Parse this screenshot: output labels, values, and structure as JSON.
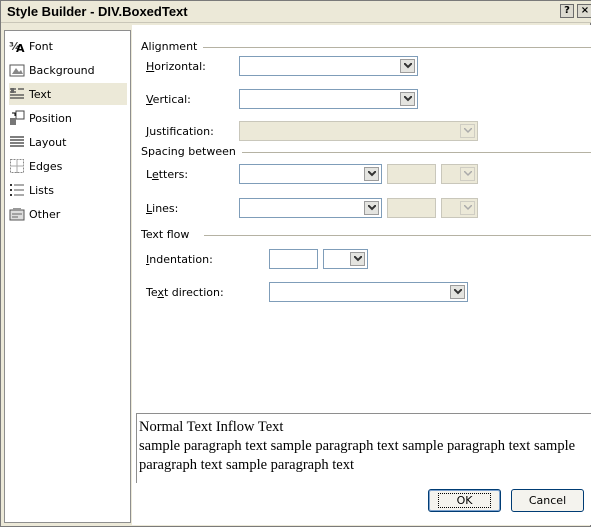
{
  "window": {
    "title": "Style Builder - DIV.BoxedText",
    "help_btn": "?",
    "close_btn": "×"
  },
  "sidebar": {
    "items": [
      {
        "label": "Font",
        "icon": "font-icon"
      },
      {
        "label": "Background",
        "icon": "background-icon"
      },
      {
        "label": "Text",
        "icon": "text-icon",
        "selected": true
      },
      {
        "label": "Position",
        "icon": "position-icon"
      },
      {
        "label": "Layout",
        "icon": "layout-icon"
      },
      {
        "label": "Edges",
        "icon": "edges-icon"
      },
      {
        "label": "Lists",
        "icon": "lists-icon"
      },
      {
        "label": "Other",
        "icon": "other-icon"
      }
    ]
  },
  "alignment": {
    "section": "Alignment",
    "horizontal_key": "H",
    "horizontal_rest": "orizontal:",
    "horizontal_value": "",
    "vertical_key": "V",
    "vertical_rest": "ertical:",
    "vertical_value": "",
    "justification_key": "J",
    "justification_rest": "ustification:",
    "justification_value": ""
  },
  "spacing": {
    "section": "Spacing between",
    "letters_pre": "L",
    "letters_key": "e",
    "letters_rest": "tters:",
    "letters_value": "",
    "letters_amount": "",
    "lines_key": "L",
    "lines_rest": "ines:",
    "lines_value": "",
    "lines_amount": ""
  },
  "textflow": {
    "section": "Text flow",
    "indentation_key": "I",
    "indentation_rest": "ndentation:",
    "indentation_value": "",
    "indentation_unit": "",
    "direction_pre": "Te",
    "direction_key": "x",
    "direction_rest": "t direction:",
    "direction_value": ""
  },
  "preview": {
    "line1": "Normal Text Inflow Text",
    "line2": "sample paragraph text sample paragraph text sample paragraph text sample paragraph text sample paragraph text"
  },
  "buttons": {
    "ok": "OK",
    "cancel": "Cancel"
  },
  "colors": {
    "dialog_bg": "#ece9d8",
    "field_border": "#7f9db9",
    "button_border": "#003c74"
  }
}
